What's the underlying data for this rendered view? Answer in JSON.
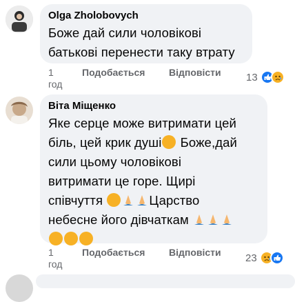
{
  "comments": [
    {
      "author": "Olga Zholobovych",
      "text_lines": [
        "Боже дай сили чоловікові",
        "батькові перенести таку втрату"
      ],
      "time_line1": "1",
      "time_line2": "год",
      "like_label": "Подобається",
      "reply_label": "Відповісти",
      "reaction_count": "13",
      "avatar_icon": "user-avatar-photo"
    },
    {
      "author": "Віта Міщенко",
      "line1": "Яке серце може витримати цей",
      "line2a": "біль, цей крик душі",
      "line2b": " Боже,дай",
      "line3": "сили цьому чоловікові",
      "line4": "витримати це горе. Щирі",
      "line5a": "співчуття ",
      "line5b": "Царство",
      "line6a": "небесне його дівчаткам ",
      "time_line1": "1",
      "time_line2": "год",
      "like_label": "Подобається",
      "reply_label": "Відповісти",
      "reaction_count": "23",
      "avatar_icon": "user-avatar-photo"
    }
  ],
  "colors": {
    "bubble": "#f0f2f5",
    "meta_text": "#65676b",
    "like_blue": "#1877f2",
    "sad_yellow": "#f7b125"
  }
}
